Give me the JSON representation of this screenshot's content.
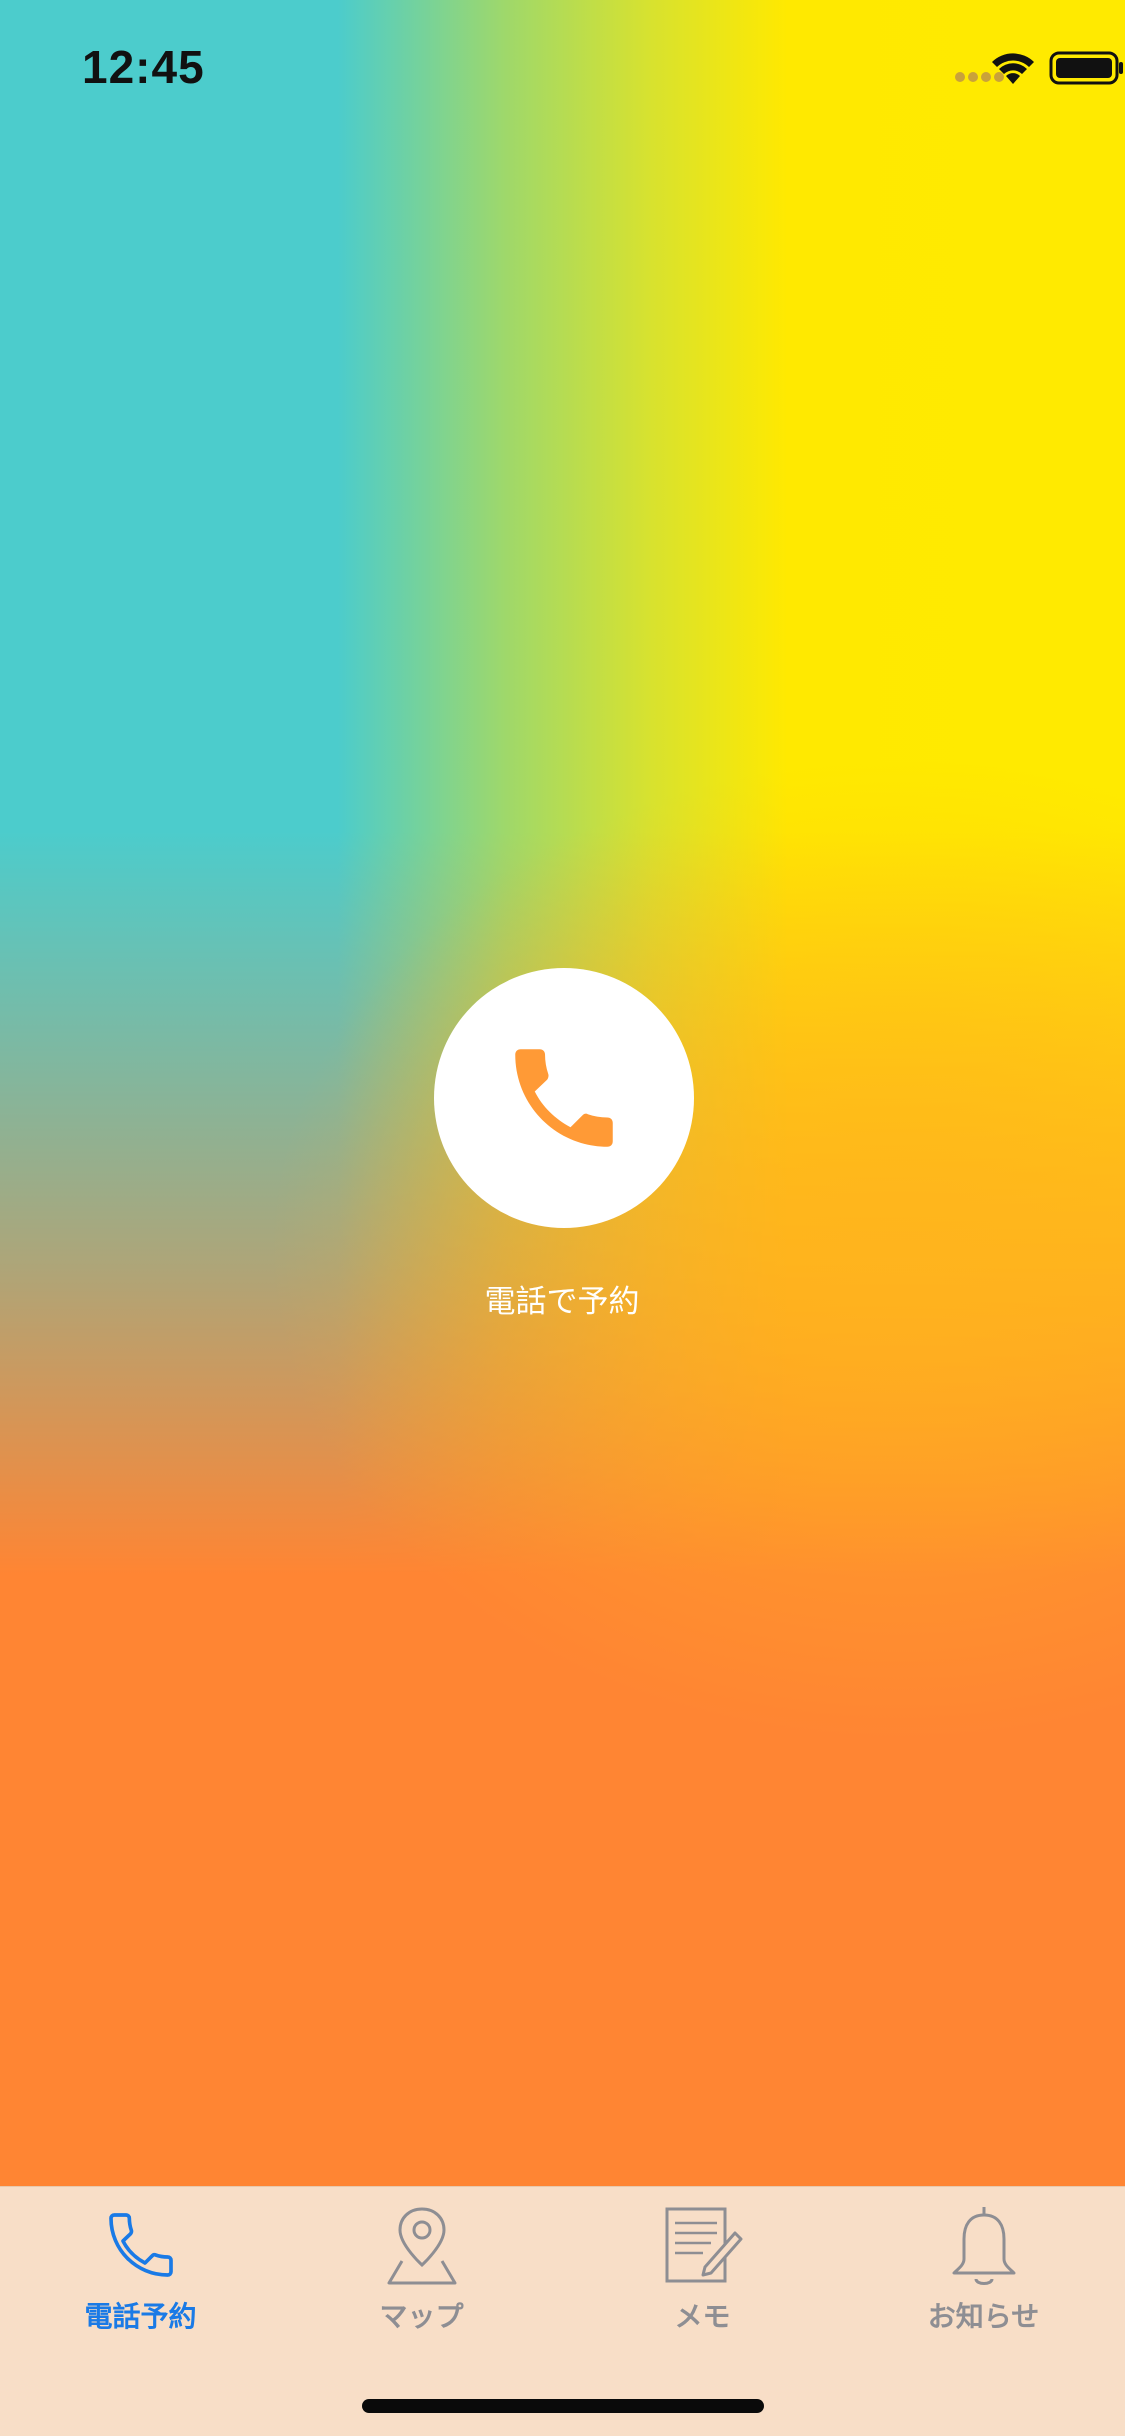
{
  "status_bar": {
    "time": "12:45"
  },
  "main": {
    "call_button_icon": "phone-icon",
    "call_label": "電話で予約",
    "accent_color": "#ff9a36"
  },
  "tab_bar": {
    "active_color": "#1a7ae6",
    "inactive_color": "#8e8e93",
    "tabs": [
      {
        "label": "電話予約",
        "icon": "phone-icon",
        "active": true
      },
      {
        "label": "マップ",
        "icon": "map-pin-icon",
        "active": false
      },
      {
        "label": "メモ",
        "icon": "memo-icon",
        "active": false
      },
      {
        "label": "お知らせ",
        "icon": "bell-icon",
        "active": false
      }
    ]
  }
}
